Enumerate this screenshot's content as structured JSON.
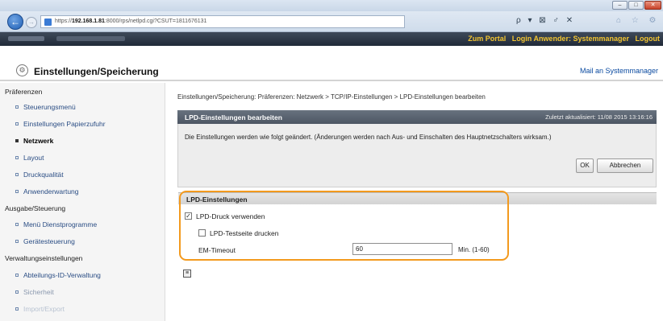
{
  "browser": {
    "url_prefix": "https://",
    "url_host": "192.168.1.81",
    "url_rest": ":8000/rps/netlpd.cgi?CSUT=1811676131",
    "search_controls": "ρ ▾ ⊠ ♂ ✕",
    "home_icons": "⌂ ☆ ⚙"
  },
  "header": {
    "links": [
      "Zum Portal",
      "Login Anwender: Systemmanager",
      "Logout"
    ]
  },
  "page": {
    "title": "Einstellungen/Speicherung",
    "mail_link": "Mail an Systemmanager"
  },
  "sidebar": {
    "groups": [
      "Präferenzen",
      "Ausgabe/Steuerung",
      "Verwaltungseinstellungen"
    ],
    "items": [
      "Steuerungsmenü",
      "Einstellungen Papierzufuhr",
      "Netzwerk",
      "Layout",
      "Druckqualität",
      "Anwenderwartung",
      "Menü Dienstprogramme",
      "Gerätesteuerung",
      "Abteilungs-ID-Verwaltung",
      "Sicherheit",
      "Import/Export"
    ]
  },
  "main": {
    "breadcrumb": "Einstellungen/Speicherung: Präferenzen: Netzwerk > TCP/IP-Einstellungen > LPD-Einstellungen bearbeiten",
    "panel_title": "LPD-Einstellungen bearbeiten",
    "last_updated": "Zuletzt aktualisiert: 11/08 2015 13:16:16",
    "notice": "Die Einstellungen werden wie folgt geändert. (Änderungen werden nach Aus- und Einschalten des Hauptnetzschalters wirksam.)",
    "ok_label": "OK",
    "cancel_label": "Abbrechen",
    "settings_title": "LPD-Einstellungen",
    "use_lpd_label": "LPD-Druck verwenden",
    "use_lpd_checked": "✓",
    "banner_label": "LPD-Testseite drucken",
    "timeout_label": "EM-Timeout",
    "timeout_value": "60",
    "timeout_unit": "Min. (1-60)",
    "page_top_icon": "≡"
  }
}
